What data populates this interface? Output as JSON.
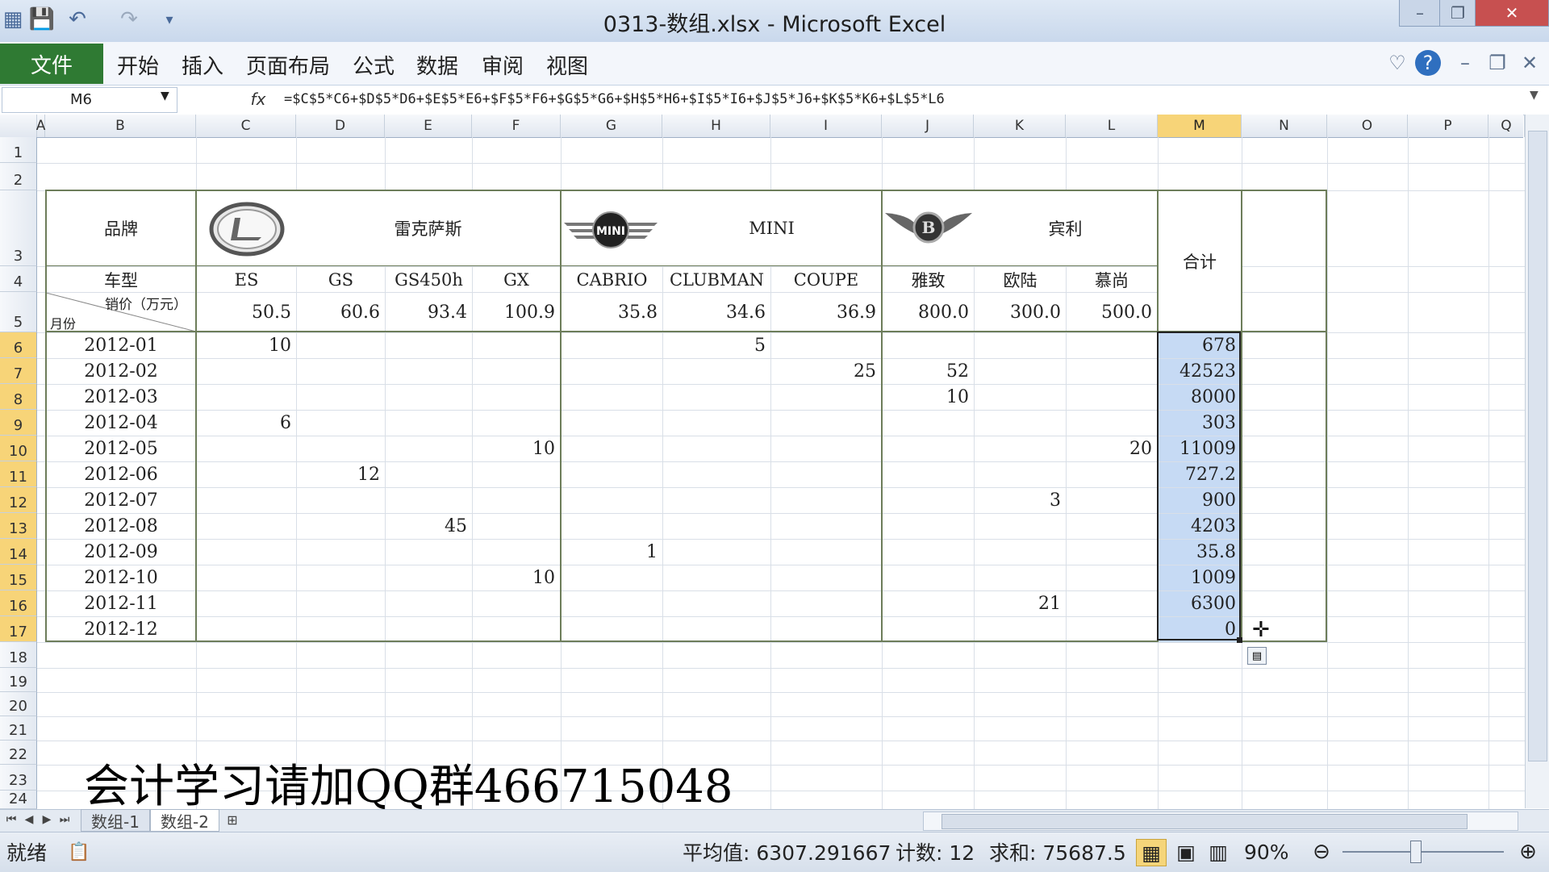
{
  "window": {
    "title": "0313-数组.xlsx  -  Microsoft Excel",
    "minimize": "–",
    "restore": "❐",
    "close": "✕"
  },
  "ribbon": {
    "file_tab": "文件",
    "tabs": [
      "开始",
      "插入",
      "页面布局",
      "公式",
      "数据",
      "审阅",
      "视图"
    ]
  },
  "formula_bar": {
    "name_box": "M6",
    "fx": "fx",
    "formula": "=$C$5*C6+$D$5*D6+$E$5*E6+$F$5*F6+$G$5*G6+$H$5*H6+$I$5*I6+$J$5*J6+$K$5*K6+$L$5*L6"
  },
  "columns": [
    "A",
    "B",
    "C",
    "D",
    "E",
    "F",
    "G",
    "H",
    "I",
    "J",
    "K",
    "L",
    "M",
    "N",
    "O",
    "P",
    "Q"
  ],
  "rows": [
    "1",
    "2",
    "3",
    "4",
    "5",
    "6",
    "7",
    "8",
    "9",
    "10",
    "11",
    "12",
    "13",
    "14",
    "15",
    "16",
    "17",
    "18",
    "19",
    "20",
    "21",
    "22",
    "23",
    "24"
  ],
  "table": {
    "brand_label": "品牌",
    "model_label": "车型",
    "price_label": "销价（万元）",
    "month_label": "月份",
    "total_label": "合计",
    "brands": [
      "雷克萨斯",
      "MINI",
      "宾利"
    ],
    "logo_texts": [
      "MINI",
      "B"
    ],
    "models": [
      "ES",
      "GS",
      "GS450h",
      "GX",
      "CABRIO",
      "CLUBMAN",
      "COUPE",
      "雅致",
      "欧陆",
      "慕尚"
    ],
    "prices": [
      "50.5",
      "60.6",
      "93.4",
      "100.9",
      "35.8",
      "34.6",
      "36.9",
      "800.0",
      "300.0",
      "500.0"
    ],
    "months": [
      "2012-01",
      "2012-02",
      "2012-03",
      "2012-04",
      "2012-05",
      "2012-06",
      "2012-07",
      "2012-08",
      "2012-09",
      "2012-10",
      "2012-11",
      "2012-12"
    ],
    "values": [
      [
        "10",
        "",
        "",
        "",
        "",
        "5",
        "",
        "",
        "",
        ""
      ],
      [
        "",
        "",
        "",
        "",
        "",
        "",
        "25",
        "52",
        "",
        ""
      ],
      [
        "",
        "",
        "",
        "",
        "",
        "",
        "",
        "10",
        "",
        ""
      ],
      [
        "6",
        "",
        "",
        "",
        "",
        "",
        "",
        "",
        "",
        ""
      ],
      [
        "",
        "",
        "",
        "10",
        "",
        "",
        "",
        "",
        "",
        "20"
      ],
      [
        "",
        "12",
        "",
        "",
        "",
        "",
        "",
        "",
        "",
        ""
      ],
      [
        "",
        "",
        "",
        "",
        "",
        "",
        "",
        "",
        "3",
        ""
      ],
      [
        "",
        "",
        "45",
        "",
        "",
        "",
        "",
        "",
        "",
        ""
      ],
      [
        "",
        "",
        "",
        "",
        "1",
        "",
        "",
        "",
        "",
        ""
      ],
      [
        "",
        "",
        "",
        "10",
        "",
        "",
        "",
        "",
        "",
        ""
      ],
      [
        "",
        "",
        "",
        "",
        "",
        "",
        "",
        "",
        "21",
        ""
      ],
      [
        "",
        "",
        "",
        "",
        "",
        "",
        "",
        "",
        "",
        ""
      ]
    ],
    "totals": [
      "678",
      "42523",
      "8000",
      "303",
      "11009",
      "727.2",
      "900",
      "4203",
      "35.8",
      "1009",
      "6300",
      "0"
    ]
  },
  "sheets": [
    "数组-1",
    "数组-2"
  ],
  "status": {
    "ready": "就绪",
    "average": "平均值: 6307.291667",
    "count": "计数: 12",
    "sum": "求和: 75687.5",
    "zoom": "90%"
  },
  "watermark": "会计学习请加QQ群466715048"
}
